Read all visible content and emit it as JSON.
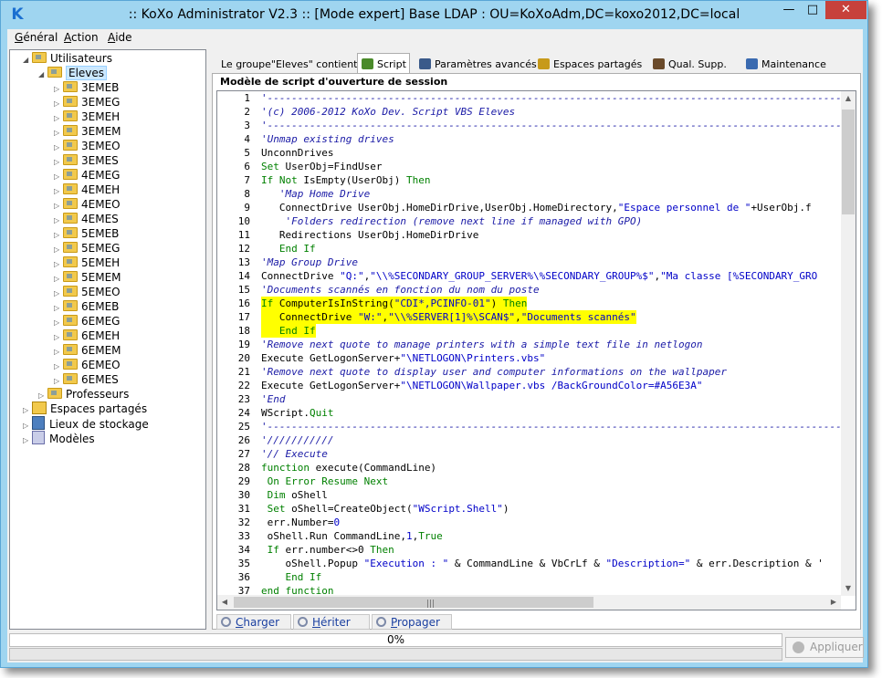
{
  "window": {
    "title": ":: KoXo Administrator V2.3 :: [Mode expert] Base LDAP : OU=KoXoAdm,DC=koxo2012,DC=local",
    "app_icon_letter": "K"
  },
  "menu": [
    {
      "label": "Général",
      "accel": "G",
      "rest": "énéral"
    },
    {
      "label": "Action",
      "accel": "A",
      "rest": "ction"
    },
    {
      "label": "Aide",
      "accel": "A",
      "rest": "ide"
    }
  ],
  "tree": {
    "root": "Utilisateurs",
    "group": "Eleves",
    "classes": [
      "3EMEB",
      "3EMEG",
      "3EMEH",
      "3EMEM",
      "3EMEO",
      "3EMES",
      "4EMEG",
      "4EMEH",
      "4EMEO",
      "4EMES",
      "5EMEB",
      "5EMEG",
      "5EMEH",
      "5EMEM",
      "5EMEO",
      "6EMEB",
      "6EMEG",
      "6EMEH",
      "6EMEM",
      "6EMEO",
      "6EMES"
    ],
    "professeurs": "Professeurs",
    "others": [
      "Espaces partagés",
      "Lieux de stockage",
      "Modèles"
    ]
  },
  "tabs": [
    {
      "label": "Le groupe\"Eleves\" contient",
      "icon": "none",
      "active": false
    },
    {
      "label": "Script",
      "icon": "script-icon",
      "active": true
    },
    {
      "label": "Paramètres avancés",
      "icon": "params-icon",
      "active": false
    },
    {
      "label": "Espaces partagés",
      "icon": "share-icon",
      "active": false
    },
    {
      "label": "Qual. Supp.",
      "icon": "users-icon",
      "active": false
    },
    {
      "label": "Maintenance",
      "icon": "maintenance-icon",
      "active": false
    }
  ],
  "script_group_title": "Modèle de script d'ouverture de session",
  "code_lines": [
    "'----------------------------------------------------------------------------------------------------",
    "'(c) 2006-2012 KoXo Dev. Script VBS Eleves",
    "'----------------------------------------------------------------------------------------------------",
    "'Unmap existing drives",
    "UnconnDrives",
    "Set UserObj=FindUser",
    "If Not IsEmpty(UserObj) Then",
    "   'Map Home Drive",
    "   ConnectDrive UserObj.HomeDirDrive,UserObj.HomeDirectory,\"Espace personnel de \"+UserObj.f",
    "    'Folders redirection (remove next line if managed with GPO)",
    "   Redirections UserObj.HomeDirDrive",
    "   End If",
    "'Map Group Drive",
    "ConnectDrive \"Q:\",\"\\\\%SECONDARY_GROUP_SERVER%\\%SECONDARY_GROUP%$\",\"Ma classe [%SECONDARY_GRO",
    "'Documents scannés en fonction du nom du poste",
    "If ComputerIsInString(\"CDI*,PCINFO-01\") Then",
    "   ConnectDrive \"W:\",\"\\\\%SERVER[1]%\\SCAN$\",\"Documents scannés\"",
    "   End If",
    "'Remove next quote to manage printers with a simple text file in netlogon",
    "Execute GetLogonServer+\"\\NETLOGON\\Printers.vbs\"",
    "'Remove next quote to display user and computer informations on the wallpaper",
    "Execute GetLogonServer+\"\\NETLOGON\\Wallpaper.vbs /BackGroundColor=#A56E3A\"",
    "'End",
    "WScript.Quit",
    "'----------------------------------------------------------------------------------------------------",
    "'///////////",
    "'// Execute",
    "function execute(CommandLine)",
    " On Error Resume Next",
    " Dim oShell",
    " Set oShell=CreateObject(\"WScript.Shell\")",
    " err.Number=0",
    " oShell.Run CommandLine,1,True",
    " If err.number<>0 Then",
    "    oShell.Popup \"Execution : \" & CommandLine & VbCrLf & \"Description=\" & err.Description & '",
    "    End If",
    "end function"
  ],
  "highlighted_lines": [
    16,
    17,
    18
  ],
  "bottom_buttons": [
    {
      "label": "Charger",
      "accel": "C",
      "rest": "harger"
    },
    {
      "label": "Hériter",
      "accel": "H",
      "rest": "ériter"
    },
    {
      "label": "Propager",
      "accel": "P",
      "rest": "ropager"
    }
  ],
  "progress": {
    "text": "0%",
    "value": 0
  },
  "apply_label": "Appliquer"
}
